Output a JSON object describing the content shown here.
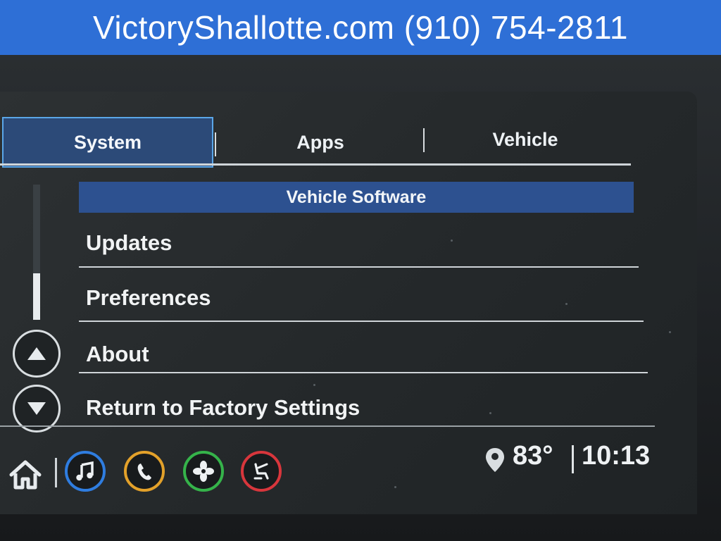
{
  "banner": {
    "text": "VictoryShallotte.com (910) 754-2811"
  },
  "tabs": [
    {
      "label": "System",
      "selected": true
    },
    {
      "label": "Apps",
      "selected": false
    },
    {
      "label": "Vehicle",
      "selected": false
    }
  ],
  "list": {
    "header": "Vehicle Software",
    "items": [
      {
        "label": "Updates"
      },
      {
        "label": "Preferences"
      },
      {
        "label": "About"
      },
      {
        "label": "Return to Factory Settings"
      }
    ]
  },
  "dock": {
    "icons": [
      {
        "name": "home-icon"
      },
      {
        "name": "music-icon",
        "color": "#2f7de0"
      },
      {
        "name": "phone-icon",
        "color": "#e3a12a"
      },
      {
        "name": "climate-fan-icon",
        "color": "#35b34a"
      },
      {
        "name": "seat-icon",
        "color": "#d8363c"
      }
    ]
  },
  "status": {
    "temperature": "83°",
    "time": "10:13",
    "location_icon": "location-pin-icon"
  },
  "colors": {
    "banner": "#2e6fd6",
    "selected_tab": "#2c4a78",
    "header": "#2d5190"
  }
}
